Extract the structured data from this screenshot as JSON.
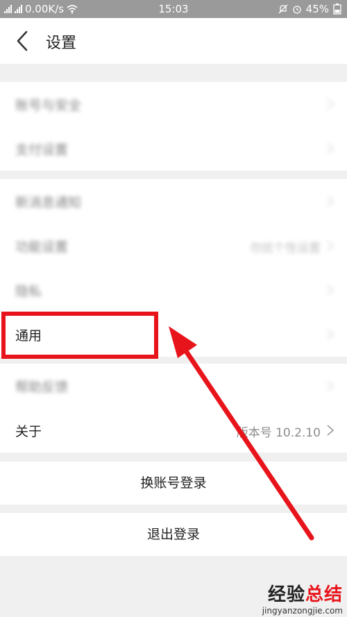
{
  "status_bar": {
    "network_speed": "0.00K/s",
    "time": "15:03",
    "battery": "45%"
  },
  "nav": {
    "title": "设置"
  },
  "section_account": {
    "items": [
      {
        "label": "账号与安全"
      },
      {
        "label": "支付设置"
      }
    ]
  },
  "section_general": {
    "items": [
      {
        "label": "新消息通知"
      },
      {
        "label": "功能设置",
        "value": "勿扰个性设置"
      },
      {
        "label": "隐私"
      },
      {
        "label": "通用"
      }
    ]
  },
  "section_about": {
    "items": [
      {
        "label": "帮助反馈"
      },
      {
        "label": "关于",
        "value": "版本号 10.2.10"
      }
    ]
  },
  "actions": {
    "switch_account": "换账号登录",
    "logout": "退出登录"
  },
  "annotation": {
    "highlight_color": "#e8141b"
  },
  "watermark": {
    "main_prefix": "经验",
    "main_accent": "总结",
    "url": "jingyanzongjie.com"
  }
}
